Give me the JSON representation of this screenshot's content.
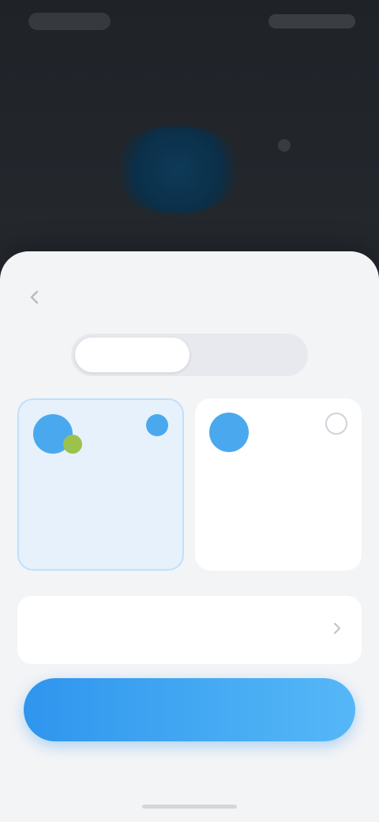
{
  "status_bar": {
    "time": "",
    "icons": [
      "signal-icon",
      "wifi-icon",
      "battery-icon"
    ]
  },
  "sheet": {
    "title": "",
    "back_icon": "chevron-left-icon"
  },
  "segmented": {
    "options": [
      {
        "label": "",
        "active": true
      },
      {
        "label": "",
        "active": false
      }
    ]
  },
  "cards": [
    {
      "title": "",
      "description": "",
      "selected": true,
      "icon": "device-icon"
    },
    {
      "title": "",
      "description": "",
      "selected": false,
      "icon": "device-icon"
    }
  ],
  "option_row": {
    "title": "",
    "subtitle": "",
    "icon": "chevron-right-icon"
  },
  "primary_button": {
    "label": ""
  },
  "footnote": "",
  "colors": {
    "accent": "#3aa1f0",
    "card_selected_bg": "#e6f1fb",
    "sheet_bg": "#f3f4f6",
    "top_bg": "#23272c"
  }
}
